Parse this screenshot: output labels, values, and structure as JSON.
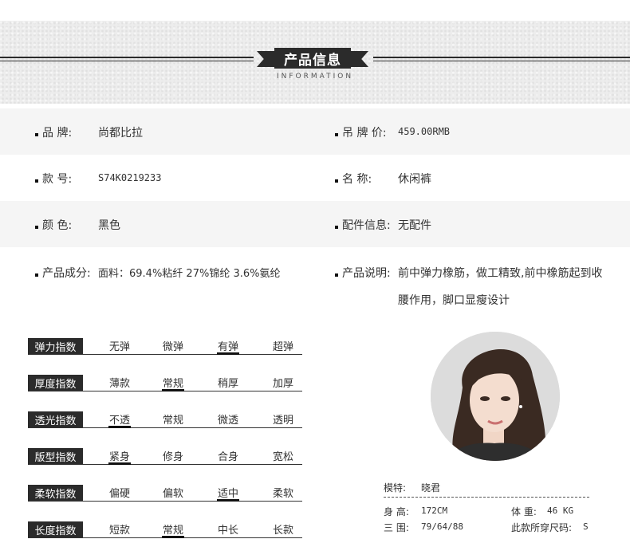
{
  "header": {
    "title": "产品信息",
    "subtitle": "INFORMATION"
  },
  "info": {
    "brand_label": "品    牌:",
    "brand_value": "尚都比拉",
    "price_label": "吊 牌 价:",
    "price_value": "459.00RMB",
    "sku_label": "款    号:",
    "sku_value": "S74K0219233",
    "name_label": "名    称:",
    "name_value": "休闲裤",
    "color_label": "颜    色:",
    "color_value": "黑色",
    "accessory_label": "配件信息:",
    "accessory_value": "无配件",
    "composition_label": "产品成分:",
    "composition_value": "面料：69.4%粘纤 27%锦纶 3.6%氨纶",
    "desc_label": "产品说明:",
    "desc_line1": "前中弹力橡筋，做工精致,前中橡筋起到收",
    "desc_line2": "腰作用，脚口显瘦设计"
  },
  "indices": [
    {
      "label": "弹力指数",
      "options": [
        "无弹",
        "微弹",
        "有弹",
        "超弹"
      ],
      "selected": 2
    },
    {
      "label": "厚度指数",
      "options": [
        "薄款",
        "常规",
        "稍厚",
        "加厚"
      ],
      "selected": 1
    },
    {
      "label": "透光指数",
      "options": [
        "不透",
        "常规",
        "微透",
        "透明"
      ],
      "selected": 0
    },
    {
      "label": "版型指数",
      "options": [
        "紧身",
        "修身",
        "合身",
        "宽松"
      ],
      "selected": 0
    },
    {
      "label": "柔软指数",
      "options": [
        "偏硬",
        "偏软",
        "适中",
        "柔软"
      ],
      "selected": 2
    },
    {
      "label": "长度指数",
      "options": [
        "短款",
        "常规",
        "中长",
        "长款"
      ],
      "selected": 1
    }
  ],
  "model": {
    "name_label": "模特:",
    "name_value": "晓君",
    "height_label": "身  高:",
    "height_value": "172CM",
    "weight_label": "体  重:",
    "weight_value": "46 KG",
    "measure_label": "三  围:",
    "measure_value": "79/64/88",
    "size_label": "此款所穿尺码:",
    "size_value": "S"
  },
  "colors": {
    "dark": "#2b2b2b",
    "band": "#ededed",
    "row_shade": "#f5f5f5"
  }
}
